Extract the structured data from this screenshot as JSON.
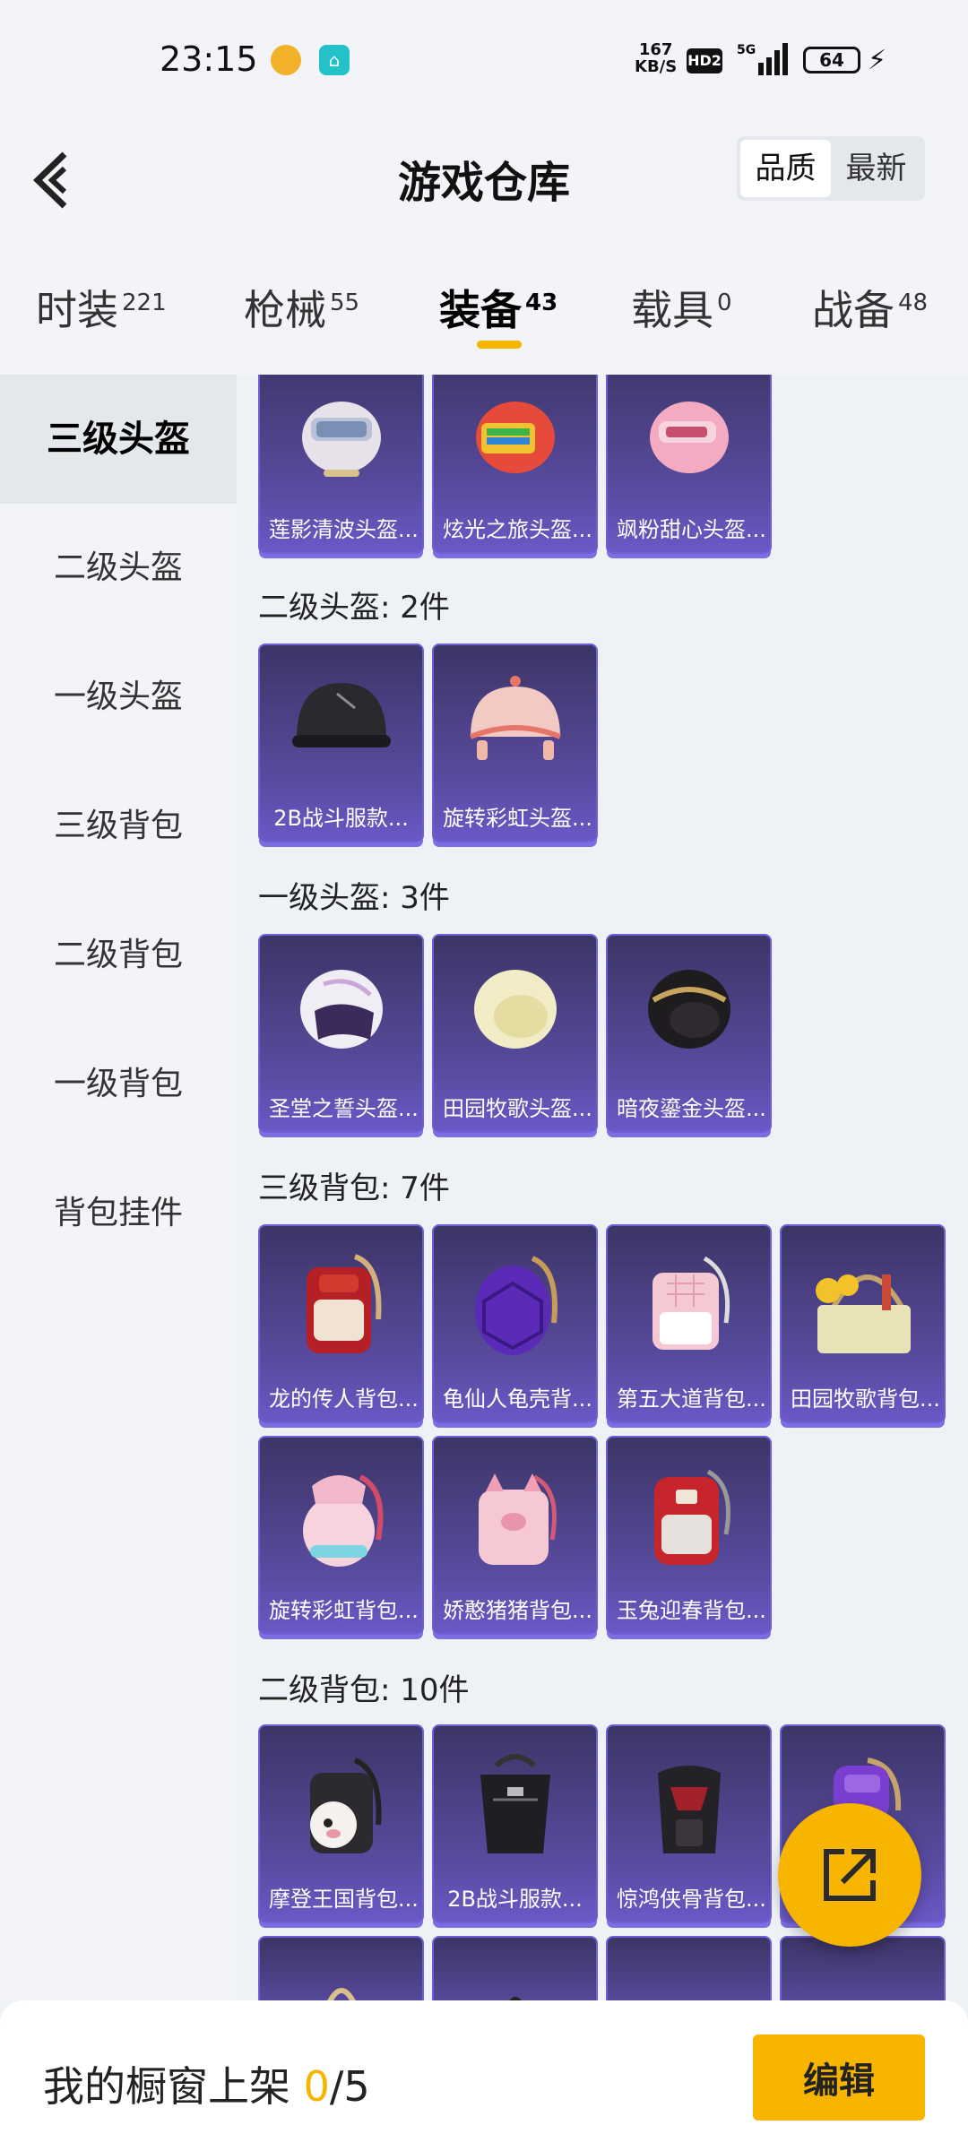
{
  "status": {
    "time": "23:15",
    "speed_value": "167",
    "speed_unit": "KB/S",
    "hd": "HD2",
    "network": "5G",
    "battery": "64"
  },
  "header": {
    "title": "游戏仓库",
    "sort_options": [
      "品质",
      "最新"
    ],
    "sort_selected": "品质"
  },
  "tabs": [
    {
      "label": "时装",
      "count": "221"
    },
    {
      "label": "枪械",
      "count": "55"
    },
    {
      "label": "装备",
      "count": "43"
    },
    {
      "label": "载具",
      "count": "0"
    },
    {
      "label": "战备",
      "count": "48"
    }
  ],
  "active_tab": "装备",
  "sidebar": [
    "三级头盔",
    "二级头盔",
    "一级头盔",
    "三级背包",
    "二级背包",
    "一级背包",
    "背包挂件"
  ],
  "sidebar_active": "三级头盔",
  "items": {
    "helmet3": [
      "莲影清波头盔...",
      "炫光之旅头盔...",
      "飒粉甜心头盔..."
    ],
    "helmet2_title": "二级头盔: 2件",
    "helmet2": [
      "2B战斗服款...",
      "旋转彩虹头盔..."
    ],
    "helmet1_title": "一级头盔: 3件",
    "helmet1": [
      "圣堂之誓头盔...",
      "田园牧歌头盔...",
      "暗夜鎏金头盔..."
    ],
    "bag3_title": "三级背包: 7件",
    "bag3": [
      "龙的传人背包...",
      "龟仙人龟壳背...",
      "第五大道背包...",
      "田园牧歌背包...",
      "旋转彩虹背包...",
      "娇憨猪猪背包...",
      "玉兔迎春背包..."
    ],
    "bag2_title": "二级背包: 10件",
    "bag2": [
      "摩登王国背包...",
      "2B战斗服款...",
      "惊鸿侠骨背包..."
    ]
  },
  "bottom": {
    "shelf_label": "我的橱窗上架 ",
    "shelf_current": "0",
    "shelf_total": "/5",
    "edit_label": "编辑"
  },
  "colors": {
    "accent": "#f7b500",
    "card_top": "#3c3566",
    "card_bottom": "#6b58c7"
  }
}
